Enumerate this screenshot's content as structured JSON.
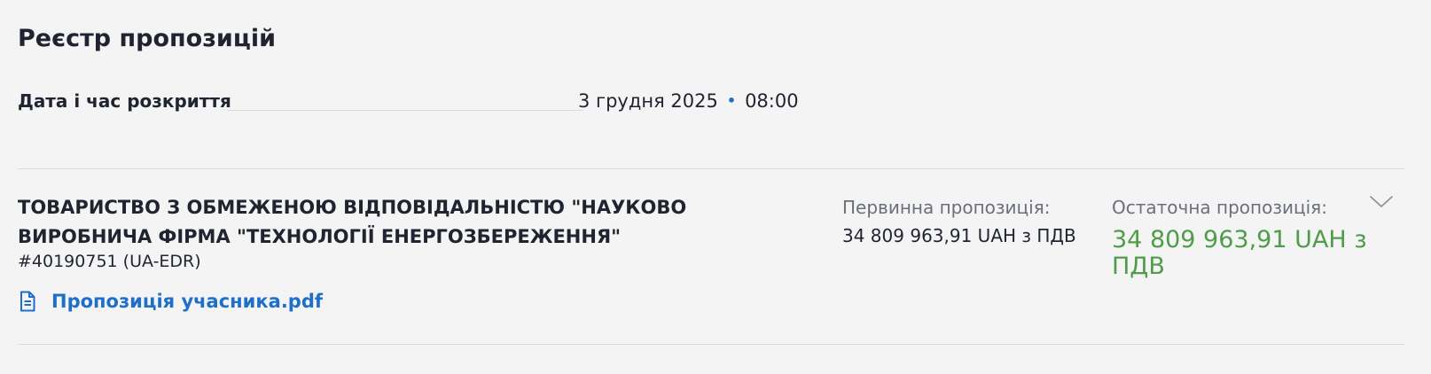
{
  "section": {
    "title": "Реєстр пропозицій"
  },
  "opening": {
    "label": "Дата і час розкриття",
    "date": "3 грудня 2025",
    "separator": "•",
    "time": "08:00"
  },
  "bid": {
    "participant_name": "ТОВАРИСТВО З ОБМЕЖЕНОЮ ВІДПОВІДАЛЬНІСТЮ \"НАУКОВО ВИРОБНИЧА ФІРМА \"ТЕХНОЛОГІЇ ЕНЕРГОЗБЕРЕЖЕННЯ\"",
    "participant_id": "#40190751 (UA-EDR)",
    "document_label": "Пропозиція учасника.pdf",
    "initial_label": "Первинна пропозиція:",
    "initial_value": "34 809 963,91 UAH з ПДВ",
    "final_label": "Остаточна пропозиція:",
    "final_value": "34 809 963,91 UAH з ПДВ"
  },
  "icons": {
    "document": "document-icon",
    "expand": "chevron-down-icon"
  },
  "colors": {
    "link": "#1e6fc8",
    "final_value": "#4f9c4a",
    "secondary_text": "#6a6f78",
    "background": "#f4f4f4"
  }
}
